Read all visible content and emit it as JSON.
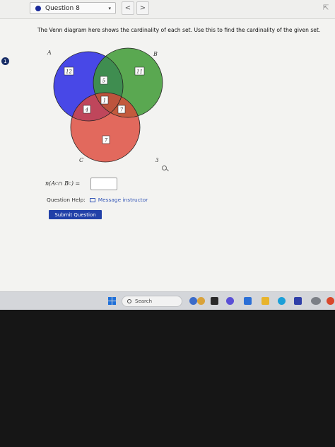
{
  "topbar": {
    "question_label": "Question 8",
    "caret": "▾",
    "prev_glyph": "<",
    "next_glyph": ">",
    "corner_glyph": "⇱"
  },
  "side_badge": "1",
  "prompt": "The Venn diagram here shows the cardinality of each set. Use this to find the cardinality of the given set.",
  "venn": {
    "set_labels": {
      "a": "A",
      "b": "B",
      "c": "C"
    },
    "regions": {
      "a_only": "12",
      "a_b_only": "5",
      "b_only": "11",
      "a_b_c": "1",
      "a_c_only": "4",
      "b_c_only": "7",
      "c_only": "7"
    },
    "outside": "3",
    "colors": {
      "a": "#3535e6",
      "b": "#3e9a35",
      "c": "#dd4638"
    }
  },
  "expression": {
    "prefix": "n(A",
    "sup1": "C",
    "middle": " ∩ B",
    "sup2": "C",
    "suffix": ") ="
  },
  "help": {
    "label": "Question Help:",
    "link": "Message instructor"
  },
  "submit_label": "Submit Question",
  "taskbar": {
    "search_label": "Search"
  }
}
